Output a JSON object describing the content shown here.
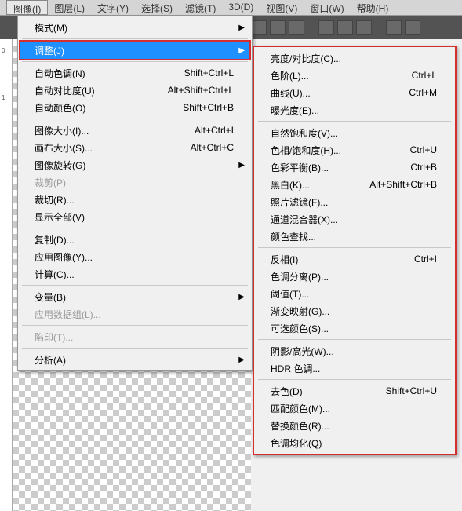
{
  "menubar": {
    "image": "图像(I)",
    "layer": "图层(L)",
    "type": "文字(Y)",
    "select": "选择(S)",
    "filter": "滤镜(T)",
    "threeD": "3D(D)",
    "view": "视图(V)",
    "window": "窗口(W)",
    "help": "帮助(H)"
  },
  "ruler": {
    "m0": "0",
    "m1": "1"
  },
  "main_menu": {
    "mode": "模式(M)",
    "adjust": "调整(J)",
    "auto_tone": "自动色调(N)",
    "auto_tone_k": "Shift+Ctrl+L",
    "auto_contrast": "自动对比度(U)",
    "auto_contrast_k": "Alt+Shift+Ctrl+L",
    "auto_color": "自动颜色(O)",
    "auto_color_k": "Shift+Ctrl+B",
    "image_size": "图像大小(I)...",
    "image_size_k": "Alt+Ctrl+I",
    "canvas_size": "画布大小(S)...",
    "canvas_size_k": "Alt+Ctrl+C",
    "image_rotation": "图像旋转(G)",
    "crop": "裁剪(P)",
    "trim": "裁切(R)...",
    "reveal_all": "显示全部(V)",
    "duplicate": "复制(D)...",
    "apply_image": "应用图像(Y)...",
    "calculations": "计算(C)...",
    "variables": "变量(B)",
    "apply_dataset": "应用数据组(L)...",
    "trap": "陷印(T)...",
    "analysis": "分析(A)"
  },
  "sub_menu": {
    "brightness": "亮度/对比度(C)...",
    "levels": "色阶(L)...",
    "levels_k": "Ctrl+L",
    "curves": "曲线(U)...",
    "curves_k": "Ctrl+M",
    "exposure": "曝光度(E)...",
    "vibrance": "自然饱和度(V)...",
    "hue_sat": "色相/饱和度(H)...",
    "hue_sat_k": "Ctrl+U",
    "color_balance": "色彩平衡(B)...",
    "color_balance_k": "Ctrl+B",
    "bw": "黑白(K)...",
    "bw_k": "Alt+Shift+Ctrl+B",
    "photo_filter": "照片滤镜(F)...",
    "channel_mixer": "通道混合器(X)...",
    "color_lookup": "颜色查找...",
    "invert": "反相(I)",
    "invert_k": "Ctrl+I",
    "posterize": "色调分离(P)...",
    "threshold": "阈值(T)...",
    "gradient_map": "渐变映射(G)...",
    "selective_color": "可选颜色(S)...",
    "shadow_highlight": "阴影/高光(W)...",
    "hdr_toning": "HDR 色调...",
    "desaturate": "去色(D)",
    "desaturate_k": "Shift+Ctrl+U",
    "match_color": "匹配颜色(M)...",
    "replace_color": "替换颜色(R)...",
    "equalize": "色调均化(Q)"
  }
}
